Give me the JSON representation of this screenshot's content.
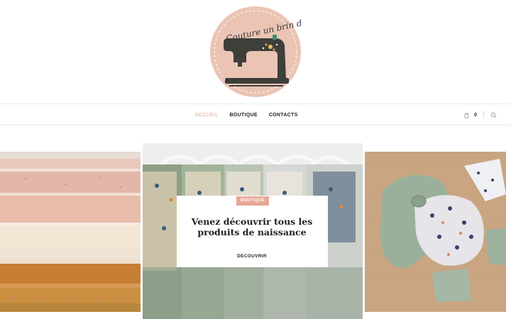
{
  "logo": {
    "text": "Couture un brin d'amour",
    "alt": "sewing-machine-logo"
  },
  "nav": {
    "items": [
      {
        "label": "ACCUEIL",
        "active": true
      },
      {
        "label": "BOUTIQUE",
        "active": false
      },
      {
        "label": "CONTACTS",
        "active": false
      }
    ],
    "cart_count": "0"
  },
  "slider": {
    "active": {
      "tag": "BOUTIQUE",
      "title": "Venez découvrir tous les produits de naissance",
      "cta": "DECOUVRIR"
    }
  },
  "colors": {
    "accent": "#e8a695",
    "logo_bg": "#ebc4b4",
    "machine": "#3d3f3b"
  }
}
